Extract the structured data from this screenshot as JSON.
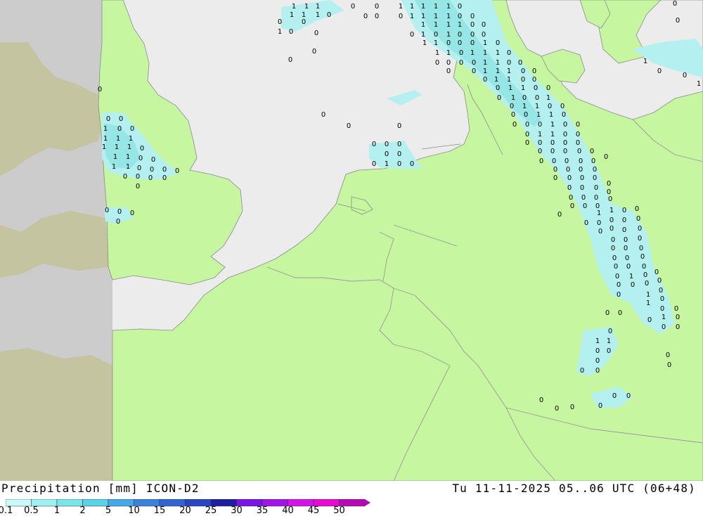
{
  "map": {
    "colors": {
      "sea": "#ececec",
      "land_model": "#c6f7a0",
      "land_outside": "#c4c4a0",
      "sea_outside": "#cccccc",
      "precip_light": "#b4f0f0",
      "precip_mid": "#96e6e6",
      "border": "#9a9a9a"
    },
    "precip_value_labels": [
      "0",
      "1"
    ]
  },
  "footer": {
    "title": "Precipitation [mm] ICON-D2",
    "run_info": "Tu 11-11-2025 05..06 UTC (06+48)"
  },
  "legend": {
    "labels": [
      "0.1",
      "0.5",
      "1",
      "2",
      "5",
      "10",
      "15",
      "20",
      "25",
      "30",
      "35",
      "40",
      "45",
      "50"
    ],
    "colors": [
      "#c8fafa",
      "#a0f0f0",
      "#78e6e6",
      "#5ad2e6",
      "#46a8e6",
      "#3c82dc",
      "#3264d2",
      "#2846be",
      "#1e1ea0",
      "#7814e6",
      "#a014e6",
      "#d214e6",
      "#e60ad2",
      "#b40ab4"
    ]
  }
}
